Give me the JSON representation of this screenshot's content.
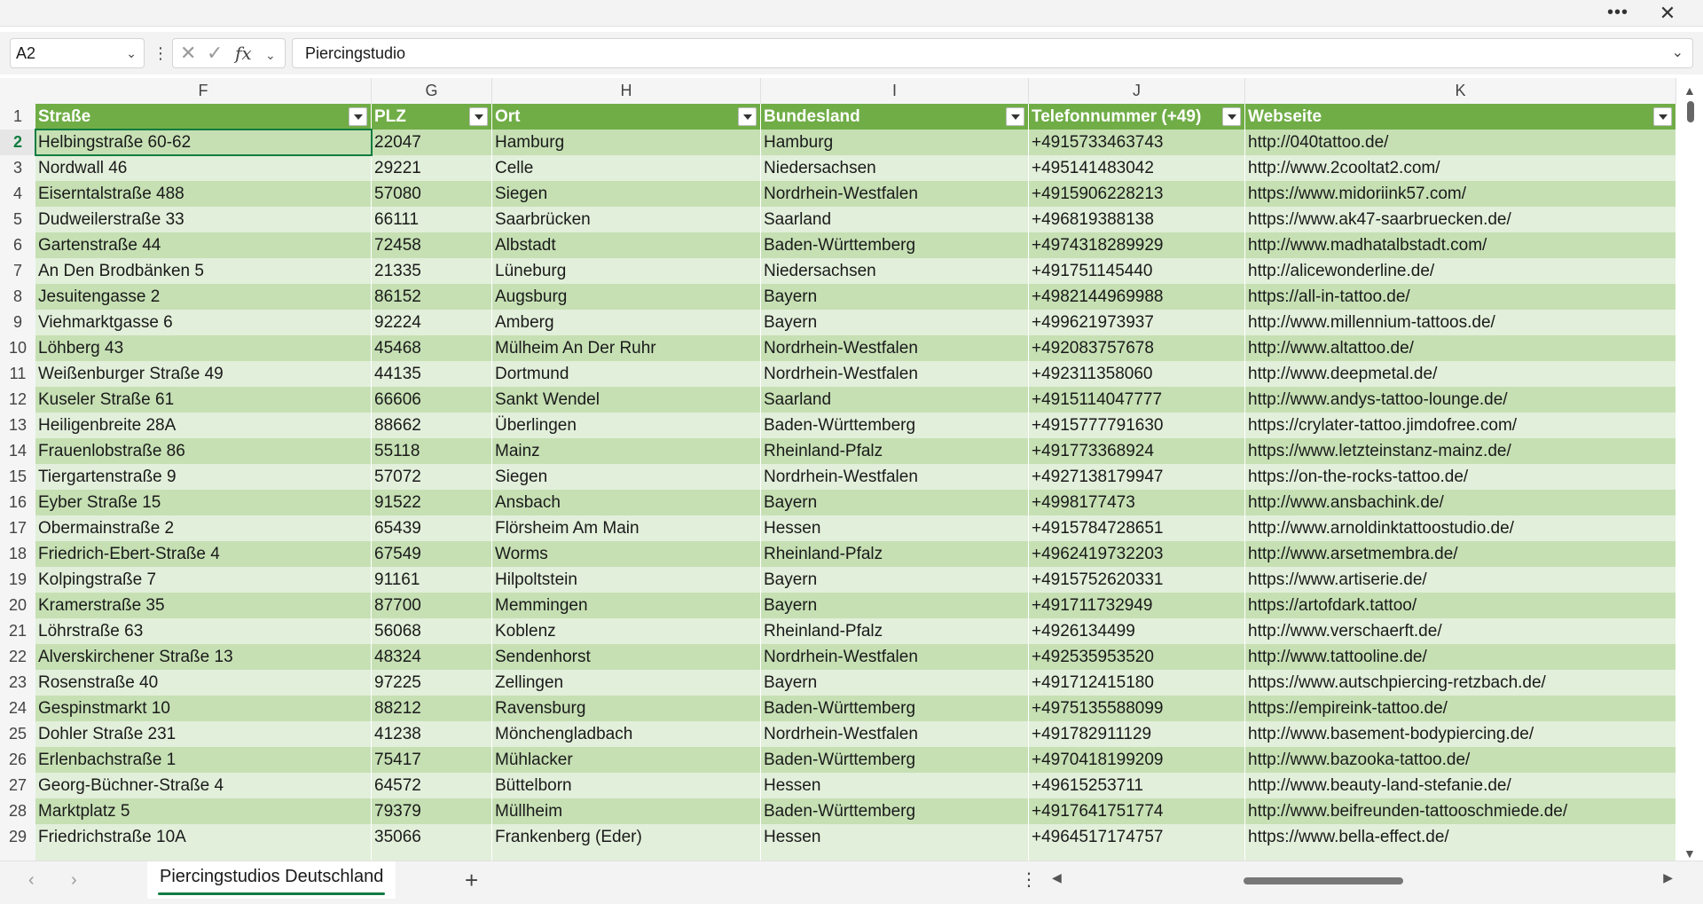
{
  "window": {
    "more_icon": "ellipsis-icon",
    "close_icon": "close-icon"
  },
  "formula_bar": {
    "name_box": "A2",
    "formula_value": "Piercingstudio",
    "cancel_icon": "cancel-icon",
    "enter_icon": "checkmark-icon",
    "fx_label": "fx"
  },
  "columns": [
    "F",
    "G",
    "H",
    "I",
    "J",
    "K"
  ],
  "header_row_number": "1",
  "headers": [
    "Straße",
    "PLZ",
    "Ort",
    "Bundesland",
    "Telefonnummer (+49)",
    "Webseite"
  ],
  "rows": [
    {
      "n": "2",
      "cells": [
        "Helbingstraße 60-62",
        "22047",
        "Hamburg",
        "Hamburg",
        "+4915733463743",
        "http://040tattoo.de/"
      ]
    },
    {
      "n": "3",
      "cells": [
        "Nordwall 46",
        "29221",
        "Celle",
        "Niedersachsen",
        "+495141483042",
        "http://www.2cooltat2.com/"
      ]
    },
    {
      "n": "4",
      "cells": [
        "Eiserntalstraße 488",
        "57080",
        "Siegen",
        "Nordrhein-Westfalen",
        "+4915906228213",
        "https://www.midoriink57.com/"
      ]
    },
    {
      "n": "5",
      "cells": [
        "Dudweilerstraße 33",
        "66111",
        "Saarbrücken",
        "Saarland",
        "+496819388138",
        "https://www.ak47-saarbruecken.de/"
      ]
    },
    {
      "n": "6",
      "cells": [
        "Gartenstraße 44",
        "72458",
        "Albstadt",
        "Baden-Württemberg",
        "+4974318289929",
        "http://www.madhatalbstadt.com/"
      ]
    },
    {
      "n": "7",
      "cells": [
        "An Den Brodbänken 5",
        "21335",
        "Lüneburg",
        "Niedersachsen",
        "+491751145440",
        "http://alicewonderline.de/"
      ]
    },
    {
      "n": "8",
      "cells": [
        "Jesuitengasse 2",
        "86152",
        "Augsburg",
        "Bayern",
        "+4982144969988",
        "https://all-in-tattoo.de/"
      ]
    },
    {
      "n": "9",
      "cells": [
        "Viehmarktgasse 6",
        "92224",
        "Amberg",
        "Bayern",
        "+499621973937",
        "http://www.millennium-tattoos.de/"
      ]
    },
    {
      "n": "10",
      "cells": [
        "Löhberg 43",
        "45468",
        "Mülheim An Der Ruhr",
        "Nordrhein-Westfalen",
        "+492083757678",
        "http://www.altattoo.de/"
      ]
    },
    {
      "n": "11",
      "cells": [
        "Weißenburger Straße 49",
        "44135",
        "Dortmund",
        "Nordrhein-Westfalen",
        "+492311358060",
        "http://www.deepmetal.de/"
      ]
    },
    {
      "n": "12",
      "cells": [
        "Kuseler Straße 61",
        "66606",
        "Sankt Wendel",
        "Saarland",
        "+4915114047777",
        "http://www.andys-tattoo-lounge.de/"
      ]
    },
    {
      "n": "13",
      "cells": [
        "Heiligenbreite 28A",
        "88662",
        "Überlingen",
        "Baden-Württemberg",
        "+4915777791630",
        "https://crylater-tattoo.jimdofree.com/"
      ]
    },
    {
      "n": "14",
      "cells": [
        "Frauenlobstraße 86",
        "55118",
        "Mainz",
        "Rheinland-Pfalz",
        "+491773368924",
        "https://www.letzteinstanz-mainz.de/"
      ]
    },
    {
      "n": "15",
      "cells": [
        "Tiergartenstraße 9",
        "57072",
        "Siegen",
        "Nordrhein-Westfalen",
        "+4927138179947",
        "https://on-the-rocks-tattoo.de/"
      ]
    },
    {
      "n": "16",
      "cells": [
        "Eyber Straße 15",
        "91522",
        "Ansbach",
        "Bayern",
        "+4998177473",
        "http://www.ansbachink.de/"
      ]
    },
    {
      "n": "17",
      "cells": [
        "Obermainstraße 2",
        "65439",
        "Flörsheim Am Main",
        "Hessen",
        "+4915784728651",
        "http://www.arnoldinktattoostudio.de/"
      ]
    },
    {
      "n": "18",
      "cells": [
        "Friedrich-Ebert-Straße 4",
        "67549",
        "Worms",
        "Rheinland-Pfalz",
        "+4962419732203",
        "http://www.arsetmembra.de/"
      ]
    },
    {
      "n": "19",
      "cells": [
        "Kolpingstraße 7",
        "91161",
        "Hilpoltstein",
        "Bayern",
        "+4915752620331",
        "https://www.artiserie.de/"
      ]
    },
    {
      "n": "20",
      "cells": [
        "Kramerstraße 35",
        "87700",
        "Memmingen",
        "Bayern",
        "+491711732949",
        "https://artofdark.tattoo/"
      ]
    },
    {
      "n": "21",
      "cells": [
        "Löhrstraße 63",
        "56068",
        "Koblenz",
        "Rheinland-Pfalz",
        "+4926134499",
        "http://www.verschaerft.de/"
      ]
    },
    {
      "n": "22",
      "cells": [
        "Alverskirchener Straße 13",
        "48324",
        "Sendenhorst",
        "Nordrhein-Westfalen",
        "+492535953520",
        "http://www.tattooline.de/"
      ]
    },
    {
      "n": "23",
      "cells": [
        "Rosenstraße 40",
        "97225",
        "Zellingen",
        "Bayern",
        "+491712415180",
        "https://www.autschpiercing-retzbach.de/"
      ]
    },
    {
      "n": "24",
      "cells": [
        "Gespinstmarkt 10",
        "88212",
        "Ravensburg",
        "Baden-Württemberg",
        "+4975135588099",
        "https://empireink-tattoo.de/"
      ]
    },
    {
      "n": "25",
      "cells": [
        "Dohler Straße 231",
        "41238",
        "Mönchengladbach",
        "Nordrhein-Westfalen",
        "+491782911129",
        "http://www.basement-bodypiercing.de/"
      ]
    },
    {
      "n": "26",
      "cells": [
        "Erlenbachstraße 1",
        "75417",
        "Mühlacker",
        "Baden-Württemberg",
        "+4970418199209",
        "http://www.bazooka-tattoo.de/"
      ]
    },
    {
      "n": "27",
      "cells": [
        "Georg-Büchner-Straße 4",
        "64572",
        "Büttelborn",
        "Hessen",
        "+49615253711",
        "http://www.beauty-land-stefanie.de/"
      ]
    },
    {
      "n": "28",
      "cells": [
        "Marktplatz 5",
        "79379",
        "Müllheim",
        "Baden-Württemberg",
        "+4917641751774",
        "http://www.beifreunden-tattooschmiede.de/"
      ]
    },
    {
      "n": "29",
      "cells": [
        "Friedrichstraße 10A",
        "35066",
        "Frankenberg (Eder)",
        "Hessen",
        "+4964517174757",
        "https://www.bella-effect.de/"
      ]
    }
  ],
  "sheet_tab": "Piercingstudios Deutschland",
  "colors": {
    "header_green": "#70ad47",
    "band_dark": "#c6e0b4",
    "band_light": "#e2efda",
    "selection": "#107c41"
  }
}
